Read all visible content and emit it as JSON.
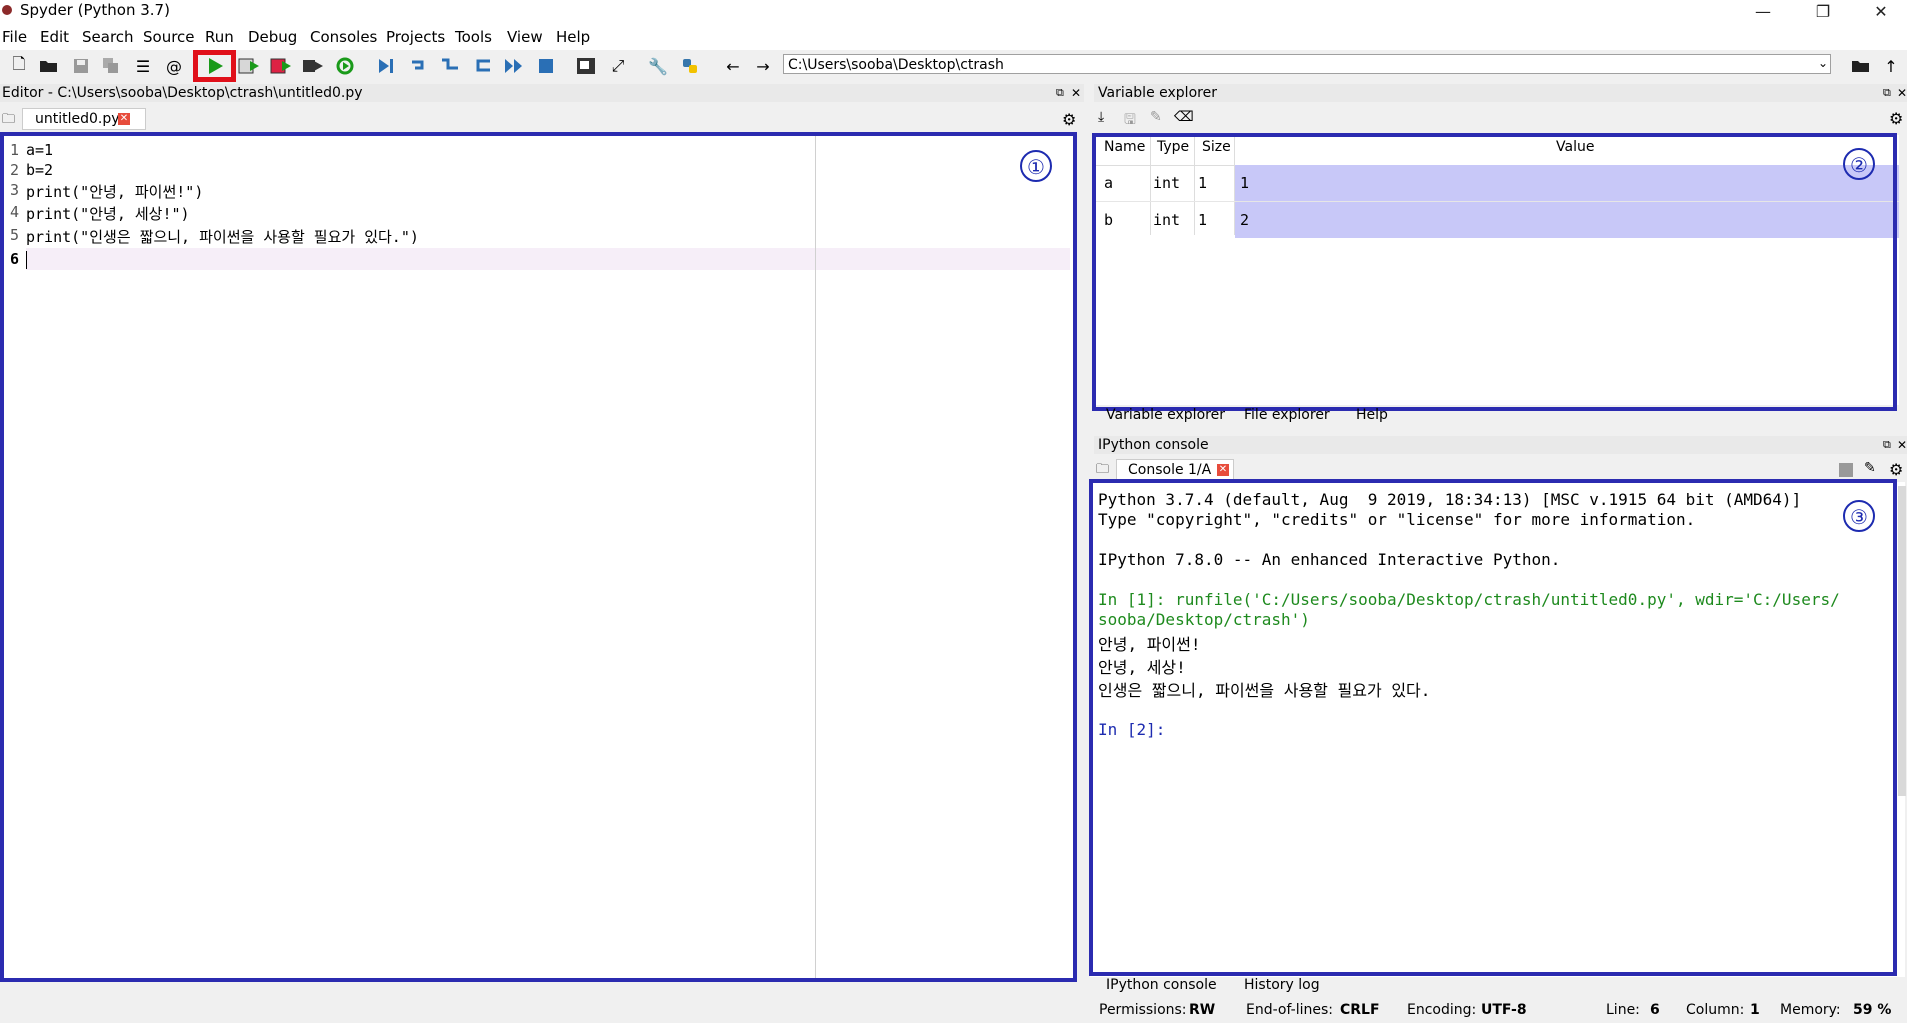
{
  "window": {
    "title": "Spyder (Python 3.7)",
    "minimize": "—",
    "restore": "❐",
    "close": "✕"
  },
  "menu": [
    "File",
    "Edit",
    "Search",
    "Source",
    "Run",
    "Debug",
    "Consoles",
    "Projects",
    "Tools",
    "View",
    "Help"
  ],
  "toolbar": {
    "path": "C:\\Users\\sooba\\Desktop\\ctrash",
    "icons": [
      "new-file",
      "open",
      "save",
      "save-all",
      "outline",
      "at",
      "run",
      "run-cell",
      "run-cell-advance",
      "run-selection",
      "re-run",
      "debug",
      "step",
      "step-into",
      "step-return",
      "continue",
      "stop",
      "maximize-pane",
      "fullscreen",
      "preferences",
      "python-path",
      "back",
      "forward",
      "browse",
      "up"
    ]
  },
  "editor": {
    "header": "Editor - C:\\Users\\sooba\\Desktop\\ctrash\\untitled0.py",
    "tab": "untitled0.py",
    "lines": [
      {
        "n": "1",
        "text": "a=1"
      },
      {
        "n": "2",
        "text": "b=2"
      },
      {
        "n": "3",
        "text": "print(\"안녕, 파이썬!\")"
      },
      {
        "n": "4",
        "text": "print(\"안녕, 세상!\")"
      },
      {
        "n": "5",
        "text": "print(\"인생은 짧으니, 파이썬을 사용할 필요가 있다.\")"
      },
      {
        "n": "6",
        "text": ""
      }
    ],
    "marker": "①"
  },
  "variable_explorer": {
    "header": "Variable explorer",
    "columns": [
      "Name",
      "Type",
      "Size",
      "Value"
    ],
    "rows": [
      {
        "name": "a",
        "type": "int",
        "size": "1",
        "value": "1"
      },
      {
        "name": "b",
        "type": "int",
        "size": "1",
        "value": "2"
      }
    ],
    "tabs": [
      "Variable explorer",
      "File explorer",
      "Help"
    ],
    "marker": "②"
  },
  "console": {
    "header": "IPython console",
    "tab": "Console 1/A",
    "lines": [
      "Python 3.7.4 (default, Aug  9 2019, 18:34:13) [MSC v.1915 64 bit (AMD64)]",
      "Type \"copyright\", \"credits\" or \"license\" for more information.",
      "",
      "IPython 7.8.0 -- An enhanced Interactive Python.",
      "",
      "In [1]: runfile('C:/Users/sooba/Desktop/ctrash/untitled0.py', wdir='C:/Users/",
      "sooba/Desktop/ctrash')",
      "안녕, 파이썬!",
      "안녕, 세상!",
      "인생은 짧으니, 파이썬을 사용할 필요가 있다.",
      "",
      "In [2]:"
    ],
    "tabs": [
      "IPython console",
      "History log"
    ],
    "marker": "③"
  },
  "status": {
    "permissions_label": "Permissions:",
    "permissions": "RW",
    "eol_label": "End-of-lines:",
    "eol": "CRLF",
    "encoding_label": "Encoding:",
    "encoding": "UTF-8",
    "line_label": "Line:",
    "line": "6",
    "column_label": "Column:",
    "column": "1",
    "memory_label": "Memory:",
    "memory": "59 %"
  }
}
